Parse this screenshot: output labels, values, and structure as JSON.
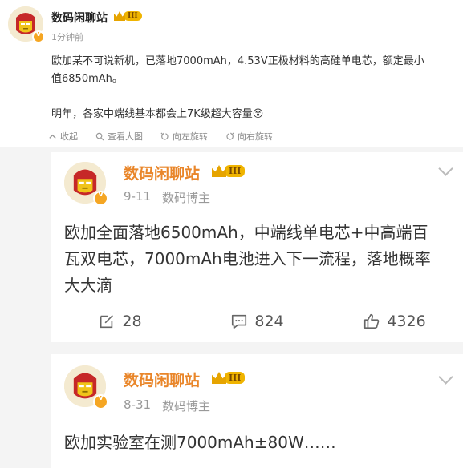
{
  "post": {
    "author": "数码闲聊站",
    "level": "III",
    "time": "1分钟前",
    "text_line1": "欧加某不可说新机，已落地7000mAh，4.53V正极材料的高硅单电芯，额定最小",
    "text_line2": "值6850mAh。",
    "text_line3": "明年，各家中端线基本都会上7K级超大容量😵",
    "actions": [
      "收起",
      "查看大图",
      "向左旋转",
      "向右旋转"
    ]
  },
  "reposts": [
    {
      "author": "数码闲聊站",
      "level": "III",
      "date": "9-11",
      "role": "数码博主",
      "lines": [
        "欧加全面落地6500mAh，中端线单电芯+中高端百",
        "瓦双电芯，7000mAh电池进入下一流程，落地概率",
        "大大滴"
      ],
      "stats": {
        "reposts": "28",
        "comments": "824",
        "likes": "4326"
      }
    },
    {
      "author": "数码闲聊站",
      "level": "III",
      "date": "8-31",
      "role": "数码博主",
      "lines": [
        "欧加实验室在测7000mAh±80W……"
      ]
    }
  ],
  "colors": {
    "accent": "#e98a1f",
    "name_orange": "#e9862a",
    "badge": "#f5a623"
  }
}
